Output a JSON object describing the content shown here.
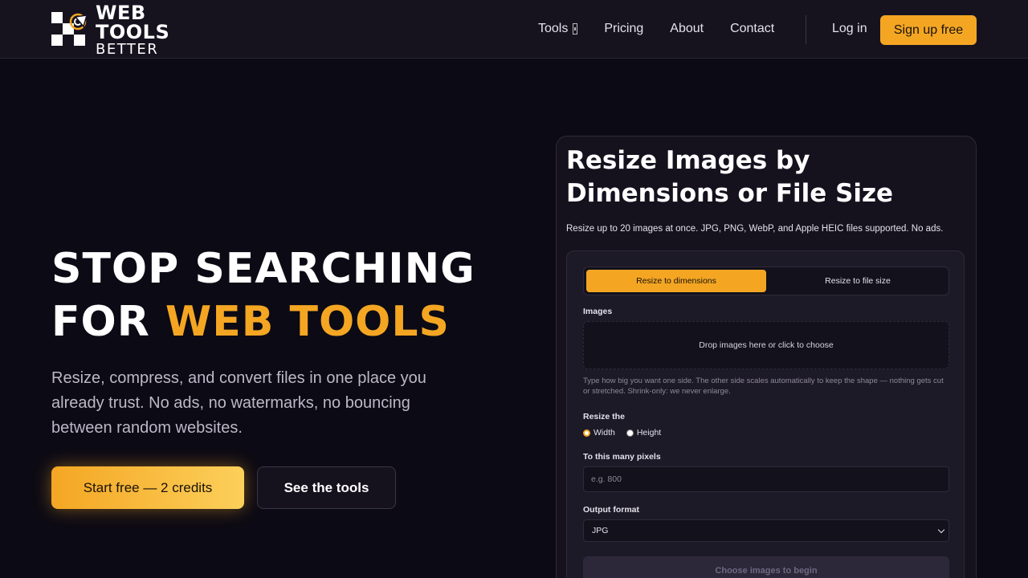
{
  "brand": {
    "line1": "WEB TOOLS",
    "line2": "BETTER",
    "accent_color": "#f4a623"
  },
  "nav": {
    "items": [
      {
        "label": "Tools",
        "icon": "chevron-down-icon"
      },
      {
        "label": "Pricing"
      },
      {
        "label": "About"
      },
      {
        "label": "Contact"
      }
    ],
    "login_label": "Log in",
    "signup_label": "Sign up free"
  },
  "hero": {
    "title_line1": "STOP SEARCHING",
    "title_line2_prefix": "FOR ",
    "title_line2_accent": "WEB TOOLS",
    "subtitle": "Resize, compress, and convert files in one place you already trust. No ads, no watermarks, no bouncing between random websites.",
    "primary_cta": "Start free — 2 credits",
    "secondary_cta": "See the tools"
  },
  "tool_card": {
    "title": "Resize Images by Dimensions or File Size",
    "description": "Resize up to 20 images at once. JPG, PNG, WebP, and Apple HEIC files supported. No ads.",
    "tabs": [
      {
        "label": "Resize to dimensions",
        "active": true
      },
      {
        "label": "Resize to file size",
        "active": false
      }
    ],
    "images_label": "Images",
    "dropzone_text": "Drop images here or click to choose",
    "help_text": "Type how big you want one side. The other side scales automatically to keep the shape — nothing gets cut or stretched. Shrink-only: we never enlarge.",
    "resize_the_label": "Resize the",
    "radio_options": [
      {
        "label": "Width",
        "selected": true
      },
      {
        "label": "Height",
        "selected": false
      }
    ],
    "pixels_label": "To this many pixels",
    "pixels_placeholder": "e.g. 800",
    "output_format_label": "Output format",
    "output_format_value": "JPG",
    "begin_button": "Choose images to begin"
  }
}
